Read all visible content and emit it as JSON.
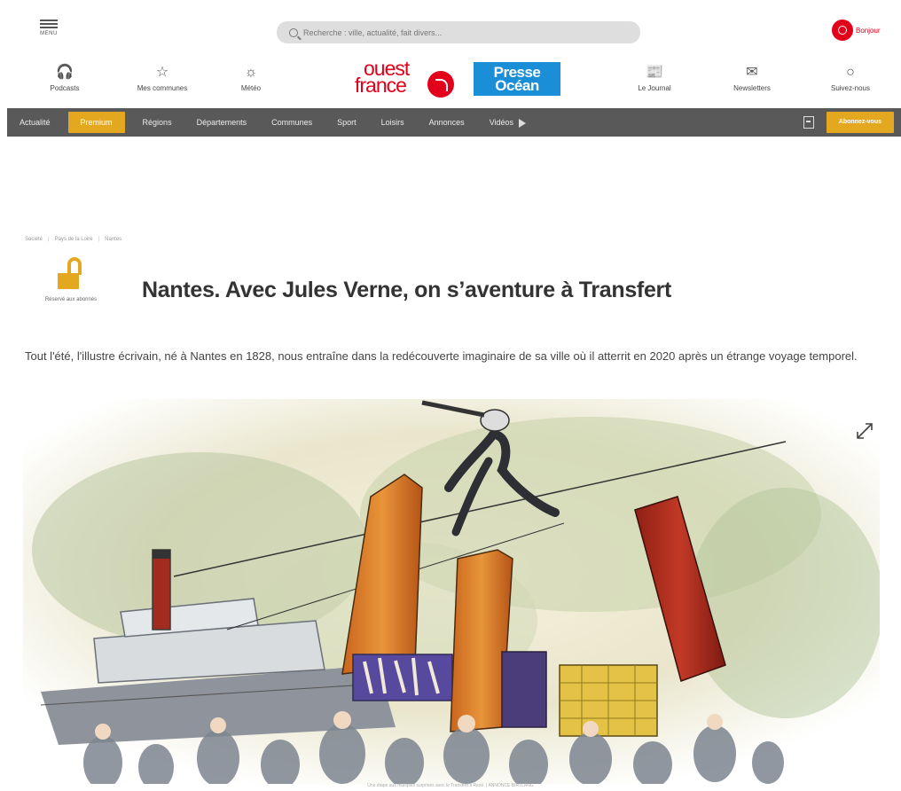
{
  "header": {
    "menu_label": "MENU",
    "search_placeholder": "Recherche : ville, actualité, fait divers...",
    "bonjour_label": "Bonjour",
    "quick_links": [
      {
        "label": "Podcasts",
        "icon": "headphones-icon",
        "glyph": "🎧"
      },
      {
        "label": "Mes communes",
        "icon": "star-icon",
        "glyph": "☆"
      },
      {
        "label": "Météo",
        "icon": "weather-icon",
        "glyph": "☼"
      },
      {
        "label": "Le Journal",
        "icon": "newspaper-icon",
        "glyph": "📰"
      },
      {
        "label": "Newsletters",
        "icon": "envelope-icon",
        "glyph": "✉"
      },
      {
        "label": "Suivez-nous",
        "icon": "follow-icon",
        "glyph": "○"
      }
    ],
    "logo_ouest_france": {
      "line1": "ouest",
      "line2": "france"
    },
    "logo_presse_ocean": {
      "line1": "Presse",
      "line2": "Océan"
    }
  },
  "nav": {
    "items": [
      "Actualité",
      "Premium",
      "Régions",
      "Départements",
      "Communes",
      "Sport",
      "Loisirs",
      "Annonces",
      "Vidéos"
    ],
    "active_index": 1,
    "subscribe_label": "Abonnez-vous"
  },
  "article": {
    "breadcrumb": [
      "Société",
      "Pays de la Loire",
      "Nantes"
    ],
    "badge_text": "Réservé aux abonnés",
    "title": "Nantes. Avec Jules Verne, on s’aventure à Transfert",
    "lede": "Tout l'été, l'illustre écrivain, né à Nantes en 1828, nous entraîne dans la redécouverte imaginaire de sa ville où il atterrit en 2020 après un étrange voyage temporel.",
    "caption": "Une étape aux multiples surprises avec le Transfert à Rezé. | ANNONCE BIRTLANG"
  },
  "colors": {
    "brand_red": "#e2001a",
    "premium_gold": "#e3a81f",
    "nav_bg": "#595959",
    "presse_ocean_blue": "#1a8fd8"
  }
}
